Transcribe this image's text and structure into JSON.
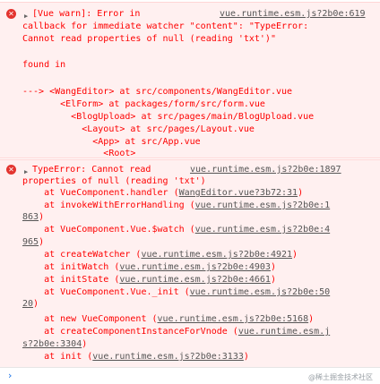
{
  "warning": {
    "line1_text": "[Vue warn]: Error in",
    "line1_link": "vue.runtime.esm.js?2b0e:619",
    "lines": [
      "callback for immediate watcher \"content\": \"TypeError:",
      "Cannot read properties of null (reading 'txt')\"",
      "",
      "found in",
      "",
      "---> <WangEditor> at src/components/WangEditor.vue",
      "       <ElForm> at packages/form/src/form.vue",
      "         <BlogUpload> at src/pages/main/BlogUpload.vue",
      "           <Layout> at src/pages/Layout.vue",
      "             <App> at src/App.vue",
      "               <Root>"
    ]
  },
  "error": {
    "line1_text": "TypeError: Cannot read",
    "line1_link": "vue.runtime.esm.js?2b0e:1897",
    "header2": "properties of null (reading 'txt')",
    "stack": [
      {
        "prefix": "    at VueComponent.handler (",
        "link": "WangEditor.vue?3b72:31",
        "suffix": ")"
      },
      {
        "prefix": "    at invokeWithErrorHandling (",
        "link": "vue.runtime.esm.js?2b0e:1",
        "suffix": ""
      },
      {
        "prefix": "",
        "link": "863",
        "suffix": ")"
      },
      {
        "prefix": "    at VueComponent.Vue.$watch (",
        "link": "vue.runtime.esm.js?2b0e:4",
        "suffix": ""
      },
      {
        "prefix": "",
        "link": "965",
        "suffix": ")"
      },
      {
        "prefix": "    at createWatcher (",
        "link": "vue.runtime.esm.js?2b0e:4921",
        "suffix": ")"
      },
      {
        "prefix": "    at initWatch (",
        "link": "vue.runtime.esm.js?2b0e:4903",
        "suffix": ")"
      },
      {
        "prefix": "    at initState (",
        "link": "vue.runtime.esm.js?2b0e:4661",
        "suffix": ")"
      },
      {
        "prefix": "    at VueComponent.Vue._init (",
        "link": "vue.runtime.esm.js?2b0e:50",
        "suffix": ""
      },
      {
        "prefix": "",
        "link": "20",
        "suffix": ")"
      },
      {
        "prefix": "    at new VueComponent (",
        "link": "vue.runtime.esm.js?2b0e:5168",
        "suffix": ")"
      },
      {
        "prefix": "    at createComponentInstanceForVnode (",
        "link": "vue.runtime.esm.j",
        "suffix": ""
      },
      {
        "prefix": "",
        "link": "s?2b0e:3304",
        "suffix": ")"
      },
      {
        "prefix": "    at init (",
        "link": "vue.runtime.esm.js?2b0e:3133",
        "suffix": ")"
      }
    ]
  },
  "icons": {
    "error": "error-circle-icon",
    "expand": "expand-triangle-icon",
    "prompt": "console-prompt-icon"
  },
  "glyphs": {
    "error": "✕",
    "expand": "▶",
    "prompt": "›"
  },
  "watermark": "@稀土掘金技术社区",
  "colors": {
    "error_text": "#fe0000",
    "error_bg": "#fff0f0",
    "link": "#555555"
  }
}
